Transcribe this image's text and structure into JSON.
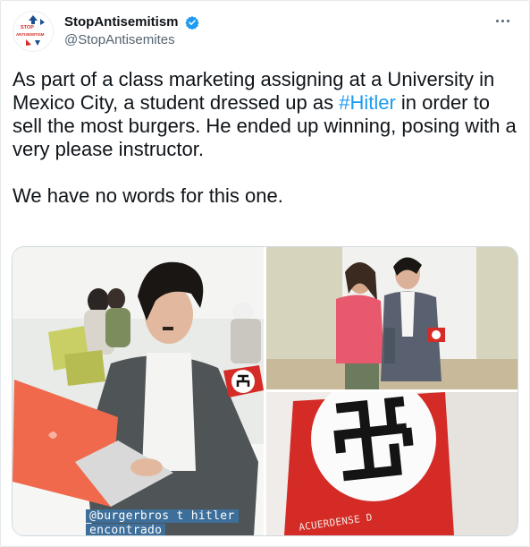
{
  "account": {
    "display_name": "StopAntisemitism",
    "handle": "@StopAntisemites",
    "avatar_logo_top": "STOP",
    "avatar_logo_bottom": "ANTISEMITISM",
    "verified": true
  },
  "tweet": {
    "text_before_hashtag": "As part of a class marketing assigning at a University in Mexico City, a student dressed up as ",
    "hashtag": "#Hitler",
    "text_after_hashtag": " in order to sell the most burgers. He ended up winning, posing with a very please instructor.",
    "second_paragraph": "We have no words for this one."
  },
  "media": {
    "left_caption_line1": "@burgerbros t hitler",
    "left_caption_line2": "encontrado",
    "bottom_right_caption": "ACUERDENSE D"
  },
  "colors": {
    "hashtag": "#1d9bf0",
    "verified": "#1d9bf0",
    "laptop": "#f0694d",
    "armband": "#d42b26"
  }
}
